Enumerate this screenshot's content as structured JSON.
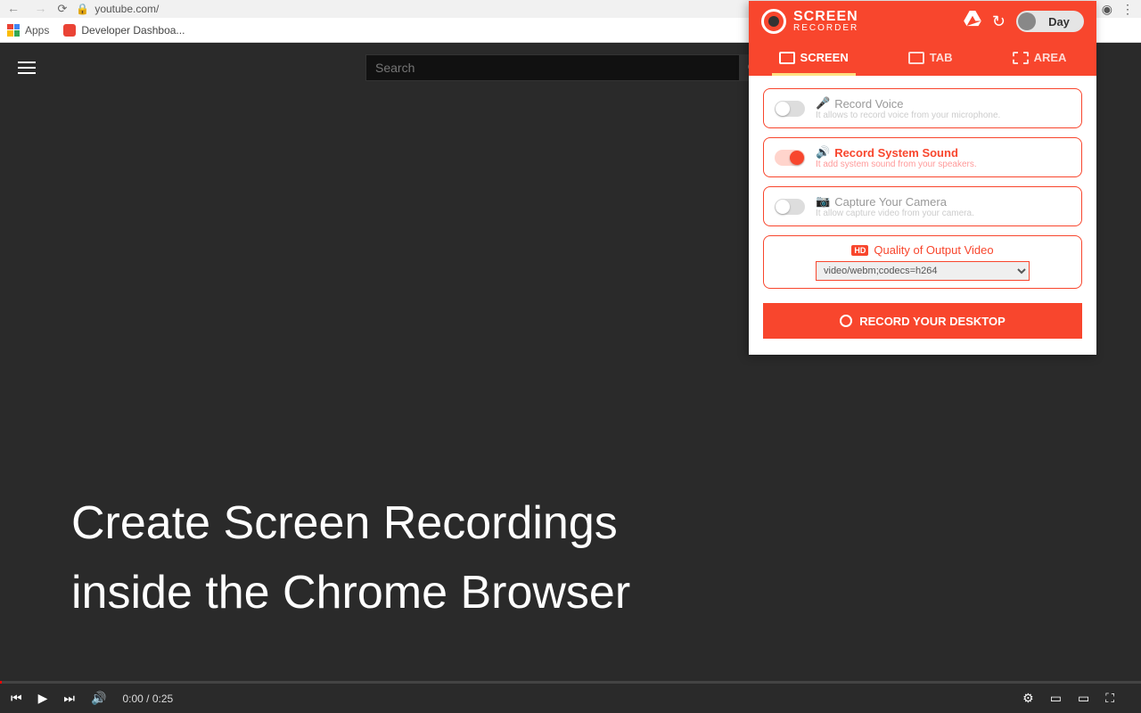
{
  "browser": {
    "url": "youtube.com/",
    "apps_label": "Apps",
    "bookmark_1": "Developer Dashboa..."
  },
  "youtube": {
    "search_placeholder": "Search",
    "overlay_line1": "Create Screen Recordings",
    "overlay_line2": "inside the Chrome Browser",
    "time_current": "0:00",
    "time_separator": " / ",
    "time_total": "0:25"
  },
  "extension": {
    "brand_line1": "SCREEN",
    "brand_line2": "RECORDER",
    "theme_label": "Day",
    "tabs": {
      "screen": "SCREEN",
      "tab": "TAB",
      "area": "AREA"
    },
    "options": {
      "voice_title": "Record Voice",
      "voice_sub": "It allows to record voice from your microphone.",
      "sound_title": "Record System Sound",
      "sound_sub": "It add system sound from your speakers.",
      "camera_title": "Capture Your Camera",
      "camera_sub": "It allow capture video from your camera."
    },
    "quality": {
      "title": "Quality of Output Video",
      "selected": "video/webm;codecs=h264"
    },
    "record_button": "RECORD YOUR DESKTOP"
  }
}
